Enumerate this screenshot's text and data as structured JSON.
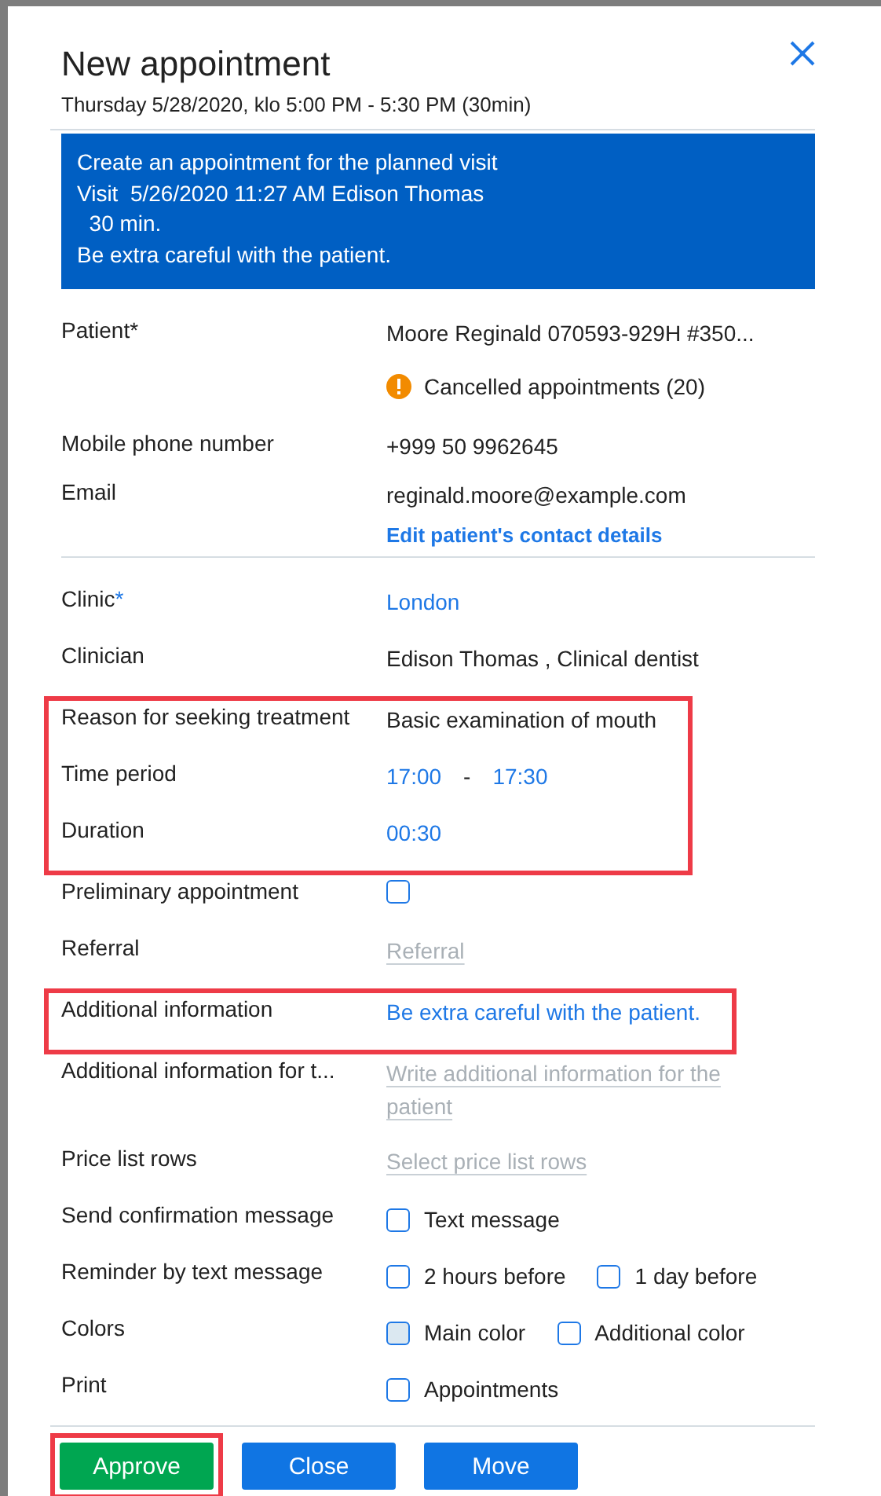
{
  "dialog": {
    "title": "New appointment",
    "subtitle": "Thursday 5/28/2020, klo 5:00 PM - 5:30 PM (30min)"
  },
  "notice": {
    "lines": [
      "Create an appointment for the planned visit",
      "Visit  5/26/2020 11:27 AM Edison Thomas",
      "  30 min.",
      "Be extra careful with the patient."
    ]
  },
  "contact": {
    "rows": [
      {
        "label": "Patient*",
        "kind": "patient",
        "value": "Moore Reginald 070593-929H #350...",
        "warning": "Cancelled appointments (20)"
      },
      {
        "label": "Mobile phone number",
        "kind": "text",
        "value": "+999 50 9962645"
      },
      {
        "label": "Email",
        "kind": "text",
        "value": "reginald.moore@example.com"
      }
    ],
    "link": "Edit patient's contact details"
  },
  "groups": [
    {
      "highlighted": false,
      "rows": [
        {
          "label": "Clinic",
          "required_mark": "*",
          "kind": "link",
          "value": "London"
        },
        {
          "label": "Clinician",
          "kind": "text",
          "value": "Edison Thomas , Clinical dentist"
        }
      ]
    },
    {
      "highlighted": true,
      "rows": [
        {
          "label": "Reason for seeking treatment",
          "kind": "text",
          "value": "Basic examination of mouth"
        },
        {
          "label": "Time period",
          "kind": "time_range",
          "start": "17:00",
          "separator": "-",
          "end": "17:30"
        },
        {
          "label": "Duration",
          "kind": "link",
          "value": "00:30"
        }
      ]
    },
    {
      "highlighted": false,
      "rows": [
        {
          "label": "Preliminary appointment",
          "kind": "checkboxes",
          "options": [
            {
              "checked": false
            }
          ]
        },
        {
          "label": "Referral",
          "kind": "field",
          "placeholder": "Referral"
        }
      ]
    },
    {
      "highlighted": true,
      "rows": [
        {
          "label": "Additional information",
          "kind": "link",
          "value": "Be extra careful with the patient."
        }
      ]
    },
    {
      "highlighted": false,
      "rows": [
        {
          "label": "Additional information for t...",
          "kind": "field",
          "placeholder": "Write additional information for the patient"
        },
        {
          "label": "Price list rows",
          "kind": "field",
          "placeholder": "Select price list rows"
        },
        {
          "label": "Send confirmation message",
          "kind": "checkboxes",
          "options": [
            {
              "label": "Text message",
              "checked": false
            }
          ]
        },
        {
          "label": "Reminder by text message",
          "kind": "checkboxes",
          "options": [
            {
              "label": "2 hours before",
              "checked": false
            },
            {
              "label": "1 day before",
              "checked": false
            }
          ]
        },
        {
          "label": "Colors",
          "kind": "checkboxes",
          "options": [
            {
              "label": "Main color",
              "checked": false,
              "color": "#dbe8f1"
            },
            {
              "label": "Additional color",
              "checked": false,
              "color": "#ffffff"
            }
          ]
        },
        {
          "label": "Print",
          "kind": "checkboxes",
          "options": [
            {
              "label": "Appointments",
              "checked": false
            }
          ]
        }
      ]
    }
  ],
  "buttons": [
    {
      "label": "Approve",
      "kind": "approve",
      "highlighted": true
    },
    {
      "label": "Close",
      "kind": "primary",
      "highlighted": false
    },
    {
      "label": "Move",
      "kind": "primary",
      "highlighted": false
    }
  ]
}
